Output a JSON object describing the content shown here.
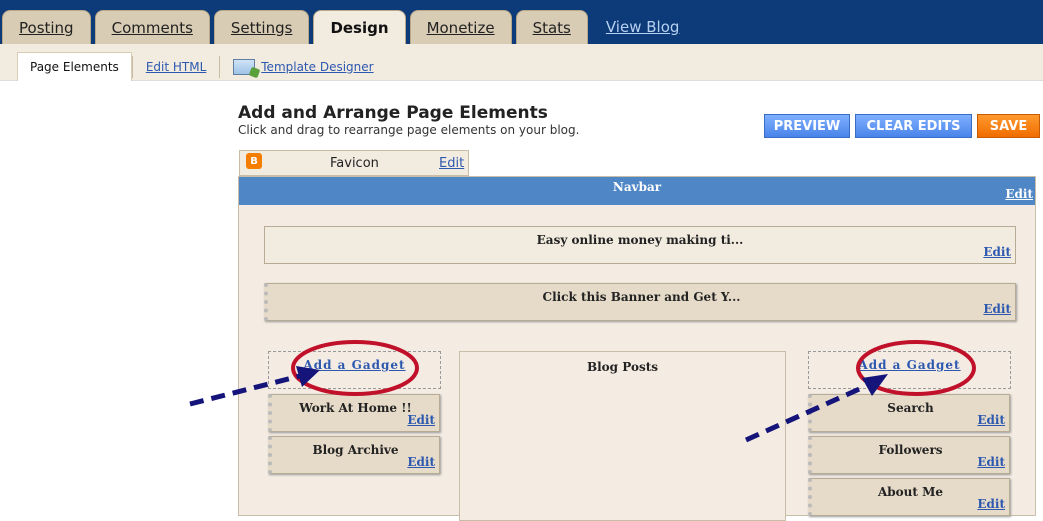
{
  "tabs": [
    {
      "label": "Posting",
      "active": false
    },
    {
      "label": "Comments",
      "active": false
    },
    {
      "label": "Settings",
      "active": false
    },
    {
      "label": "Design",
      "active": true
    },
    {
      "label": "Monetize",
      "active": false
    },
    {
      "label": "Stats",
      "active": false
    }
  ],
  "view_blog": "View Blog",
  "subtabs": {
    "page_elements": "Page Elements",
    "edit_html": "Edit HTML",
    "template_designer": "Template Designer"
  },
  "header": {
    "title": "Add and Arrange Page Elements",
    "subtitle": "Click and drag to rearrange page elements on your blog."
  },
  "buttons": {
    "preview": "PREVIEW",
    "clear_edits": "CLEAR EDITS",
    "save": "SAVE"
  },
  "favicon": {
    "label": "Favicon",
    "edit": "Edit"
  },
  "navbar": {
    "label": "Navbar",
    "edit": "Edit"
  },
  "header_gadgets": [
    {
      "label": "Easy online money making ti...",
      "edit": "Edit"
    },
    {
      "label": "Click this Banner and Get Y...",
      "edit": "Edit"
    }
  ],
  "left_sidebar": {
    "add_gadget": "Add a Gadget",
    "gadgets": [
      {
        "label": "Work At Home !!",
        "edit": "Edit"
      },
      {
        "label": "Blog Archive",
        "edit": "Edit"
      }
    ]
  },
  "main": {
    "label": "Blog Posts"
  },
  "right_sidebar": {
    "add_gadget": "Add a Gadget",
    "gadgets": [
      {
        "label": "Search",
        "edit": "Edit"
      },
      {
        "label": "Followers",
        "edit": "Edit"
      },
      {
        "label": "About Me",
        "edit": "Edit"
      }
    ]
  },
  "colors": {
    "topbar": "#0d3a78",
    "navbar": "#4f86c6",
    "button_blue": "#5a90ef",
    "button_save": "#f57d00",
    "annotation_ellipse": "#c0102a",
    "annotation_arrow": "#14147a"
  }
}
